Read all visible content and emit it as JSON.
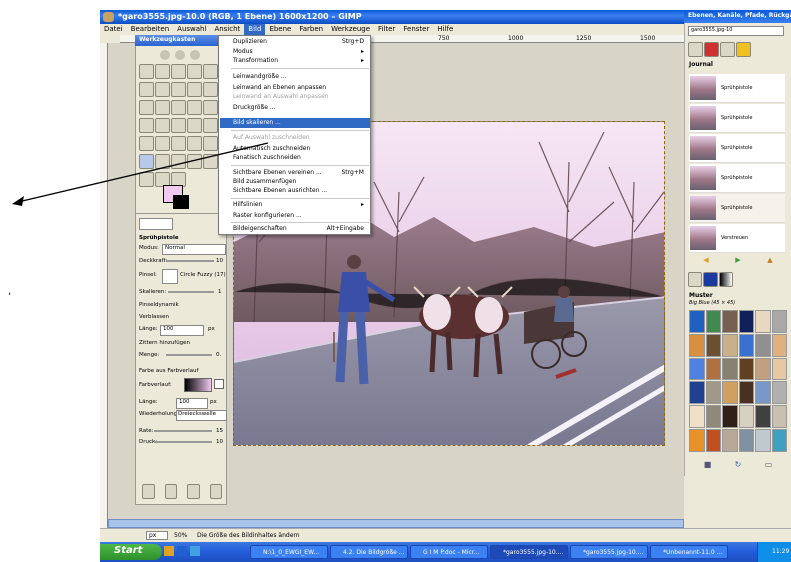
{
  "window": {
    "title": "*garo3555.jpg-10.0 (RGB, 1 Ebene) 1600x1200 – GIMP"
  },
  "menubar": [
    "Datei",
    "Bearbeiten",
    "Auswahl",
    "Ansicht",
    "Bild",
    "Ebene",
    "Farben",
    "Werkzeuge",
    "Filter",
    "Fenster",
    "Hilfe"
  ],
  "ruler_ticks": [
    "750",
    "1000",
    "1250",
    "1500"
  ],
  "toolbox": {
    "title": "Werkzeugkasten"
  },
  "tool_options": {
    "tool_name": "Sprühpistole",
    "mode_label": "Modus:",
    "mode_value": "Normal",
    "opacity_label": "Deckkraft:",
    "opacity_value": "10",
    "brush_label": "Pinsel:",
    "brush_value": "Circle Fuzzy (17)",
    "scale_label": "Skalieren:",
    "scale_value": "1",
    "dynamics_label": "Pinseldynamik",
    "fade_label": "Verblassen",
    "fade_length_label": "Länge:",
    "fade_length_value": "100",
    "fade_unit": "px",
    "jitter_label": "Zittern hinzufügen",
    "jitter_amount_label": "Menge:",
    "jitter_amount_value": "0.",
    "gradient_label": "Farbe aus Farbverlauf",
    "gradient_sub_label": "Farbverlauf:",
    "length_label": "Länge:",
    "length_value": "100",
    "length_unit": "px",
    "repeat_label": "Wiederholung:",
    "repeat_value": "Dreieckswelle",
    "rate_label": "Rate:",
    "rate_value": "15",
    "pressure_label": "Druck:",
    "pressure_value": "10"
  },
  "image_menu": {
    "items": [
      {
        "label": "Duplizieren",
        "shortcut": "Strg+D",
        "disabled": false
      },
      {
        "label": "Modus",
        "shortcut": "▸",
        "disabled": false
      },
      {
        "label": "Transformation",
        "shortcut": "▸",
        "disabled": false
      },
      {
        "label": "Leinwandgröße ...",
        "shortcut": "",
        "disabled": false
      },
      {
        "label": "Leinwand an Ebenen anpassen",
        "shortcut": "",
        "disabled": false
      },
      {
        "label": "Leinwand an Auswahl anpassen",
        "shortcut": "",
        "disabled": true
      },
      {
        "label": "Druckgröße ...",
        "shortcut": "",
        "disabled": false
      },
      {
        "label": "Bild skalieren ...",
        "shortcut": "",
        "disabled": false,
        "highlighted": true
      },
      {
        "label": "Auf Auswahl zuschneiden",
        "shortcut": "",
        "disabled": true
      },
      {
        "label": "Automatisch zuschneiden",
        "shortcut": "",
        "disabled": false
      },
      {
        "label": "Fanatisch zuschneiden",
        "shortcut": "",
        "disabled": false
      },
      {
        "label": "Sichtbare Ebenen vereinen ...",
        "shortcut": "Strg+M",
        "disabled": false
      },
      {
        "label": "Bild zusammenfügen",
        "shortcut": "",
        "disabled": false
      },
      {
        "label": "Sichtbare Ebenen ausrichten ...",
        "shortcut": "",
        "disabled": false
      },
      {
        "label": "Hilfslinien",
        "shortcut": "▸",
        "disabled": false
      },
      {
        "label": "Raster konfigurieren ...",
        "shortcut": "",
        "disabled": false
      },
      {
        "label": "Bildeigenschaften",
        "shortcut": "Alt+Eingabe",
        "disabled": false
      }
    ]
  },
  "dock": {
    "title": "Ebenen, Kanäle, Pfade, Rückgäng...",
    "image_select": "garo3555.jpg-10",
    "journal_label": "Journal",
    "journal_items": [
      "Sprühpistole",
      "Sprühpistole",
      "Sprühpistole",
      "Sprühpistole",
      "Sprühpistole",
      "Verstreuen"
    ],
    "patterns_label": "Muster",
    "patterns_sub": "Big Blue (45 × 45)"
  },
  "statusbar": {
    "unit": "px",
    "zoom": "50%",
    "message": "Die Größe des Bildinhaltes ändern"
  },
  "taskbar": {
    "start": "Start",
    "tasks": [
      "N:\\1_0_EWGI_EW...",
      "4.2. Die Bildgröße ...",
      "G I M P.doc - Micr...",
      "*garo3555.jpg-10....",
      "*garo3555.jpg-10....",
      "*Unbenannt-11.0 ..."
    ],
    "clock": "11:29"
  },
  "colors": {
    "accent": "#316ac5",
    "title_blue": "#0a5ad8",
    "taskbar": "#245edc"
  }
}
